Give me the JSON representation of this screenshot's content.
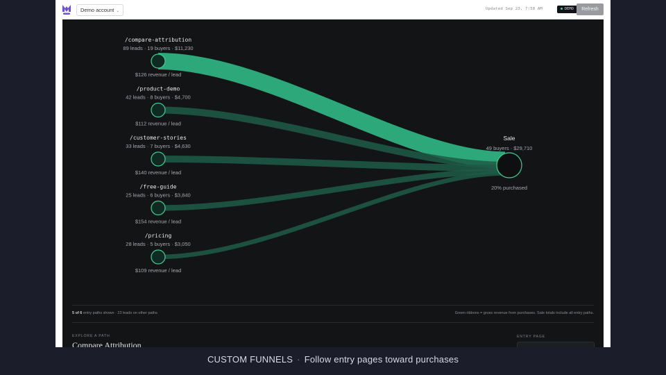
{
  "header": {
    "account": "Demo account",
    "updated": "Updated Sep 23, 7:58 AM",
    "badge": "DEMO",
    "refresh": "Refresh"
  },
  "chart_data": {
    "type": "sankey",
    "sources": [
      {
        "path": "/compare-attribution",
        "leads": 89,
        "buyers": 19,
        "revenue": 11230,
        "stats": "89 leads · 19 buyers · $11,230",
        "per_lead": "$126 revenue / lead"
      },
      {
        "path": "/product-demo",
        "leads": 42,
        "buyers": 8,
        "revenue": 4700,
        "stats": "42 leads · 8 buyers · $4,700",
        "per_lead": "$112 revenue / lead"
      },
      {
        "path": "/customer-stories",
        "leads": 33,
        "buyers": 7,
        "revenue": 4630,
        "stats": "33 leads · 7 buyers · $4,630",
        "per_lead": "$140 revenue / lead"
      },
      {
        "path": "/free-guide",
        "leads": 25,
        "buyers": 6,
        "revenue": 3840,
        "stats": "25 leads · 6 buyers · $3,840",
        "per_lead": "$154 revenue / lead"
      },
      {
        "path": "/pricing",
        "leads": 28,
        "buyers": 5,
        "revenue": 3050,
        "stats": "28 leads · 5 buyers · $3,050",
        "per_lead": "$109 revenue / lead"
      }
    ],
    "target": {
      "name": "Sale",
      "buyers": 49,
      "revenue": 29710,
      "stats": "49 buyers · $29,710",
      "note": "20% purchased"
    },
    "colors": {
      "primary": "#2fb584",
      "secondary": "#1e5a47",
      "node_stroke": "#3ecf98",
      "node_fill": "#0f2a22"
    }
  },
  "footer": {
    "shown": "5 of 6",
    "shown_rest": " entry paths shown · 23 leads on other paths",
    "note": "Green ribbons = gross revenue from purchases. Sale totals include all entry paths."
  },
  "explore": {
    "label": "EXPLORE A PATH",
    "title": "Compare Attribution",
    "entry_label": "ENTRY PAGE"
  },
  "caption": {
    "left": "CUSTOM FUNNELS",
    "sep": "·",
    "right": "Follow entry pages toward purchases"
  }
}
